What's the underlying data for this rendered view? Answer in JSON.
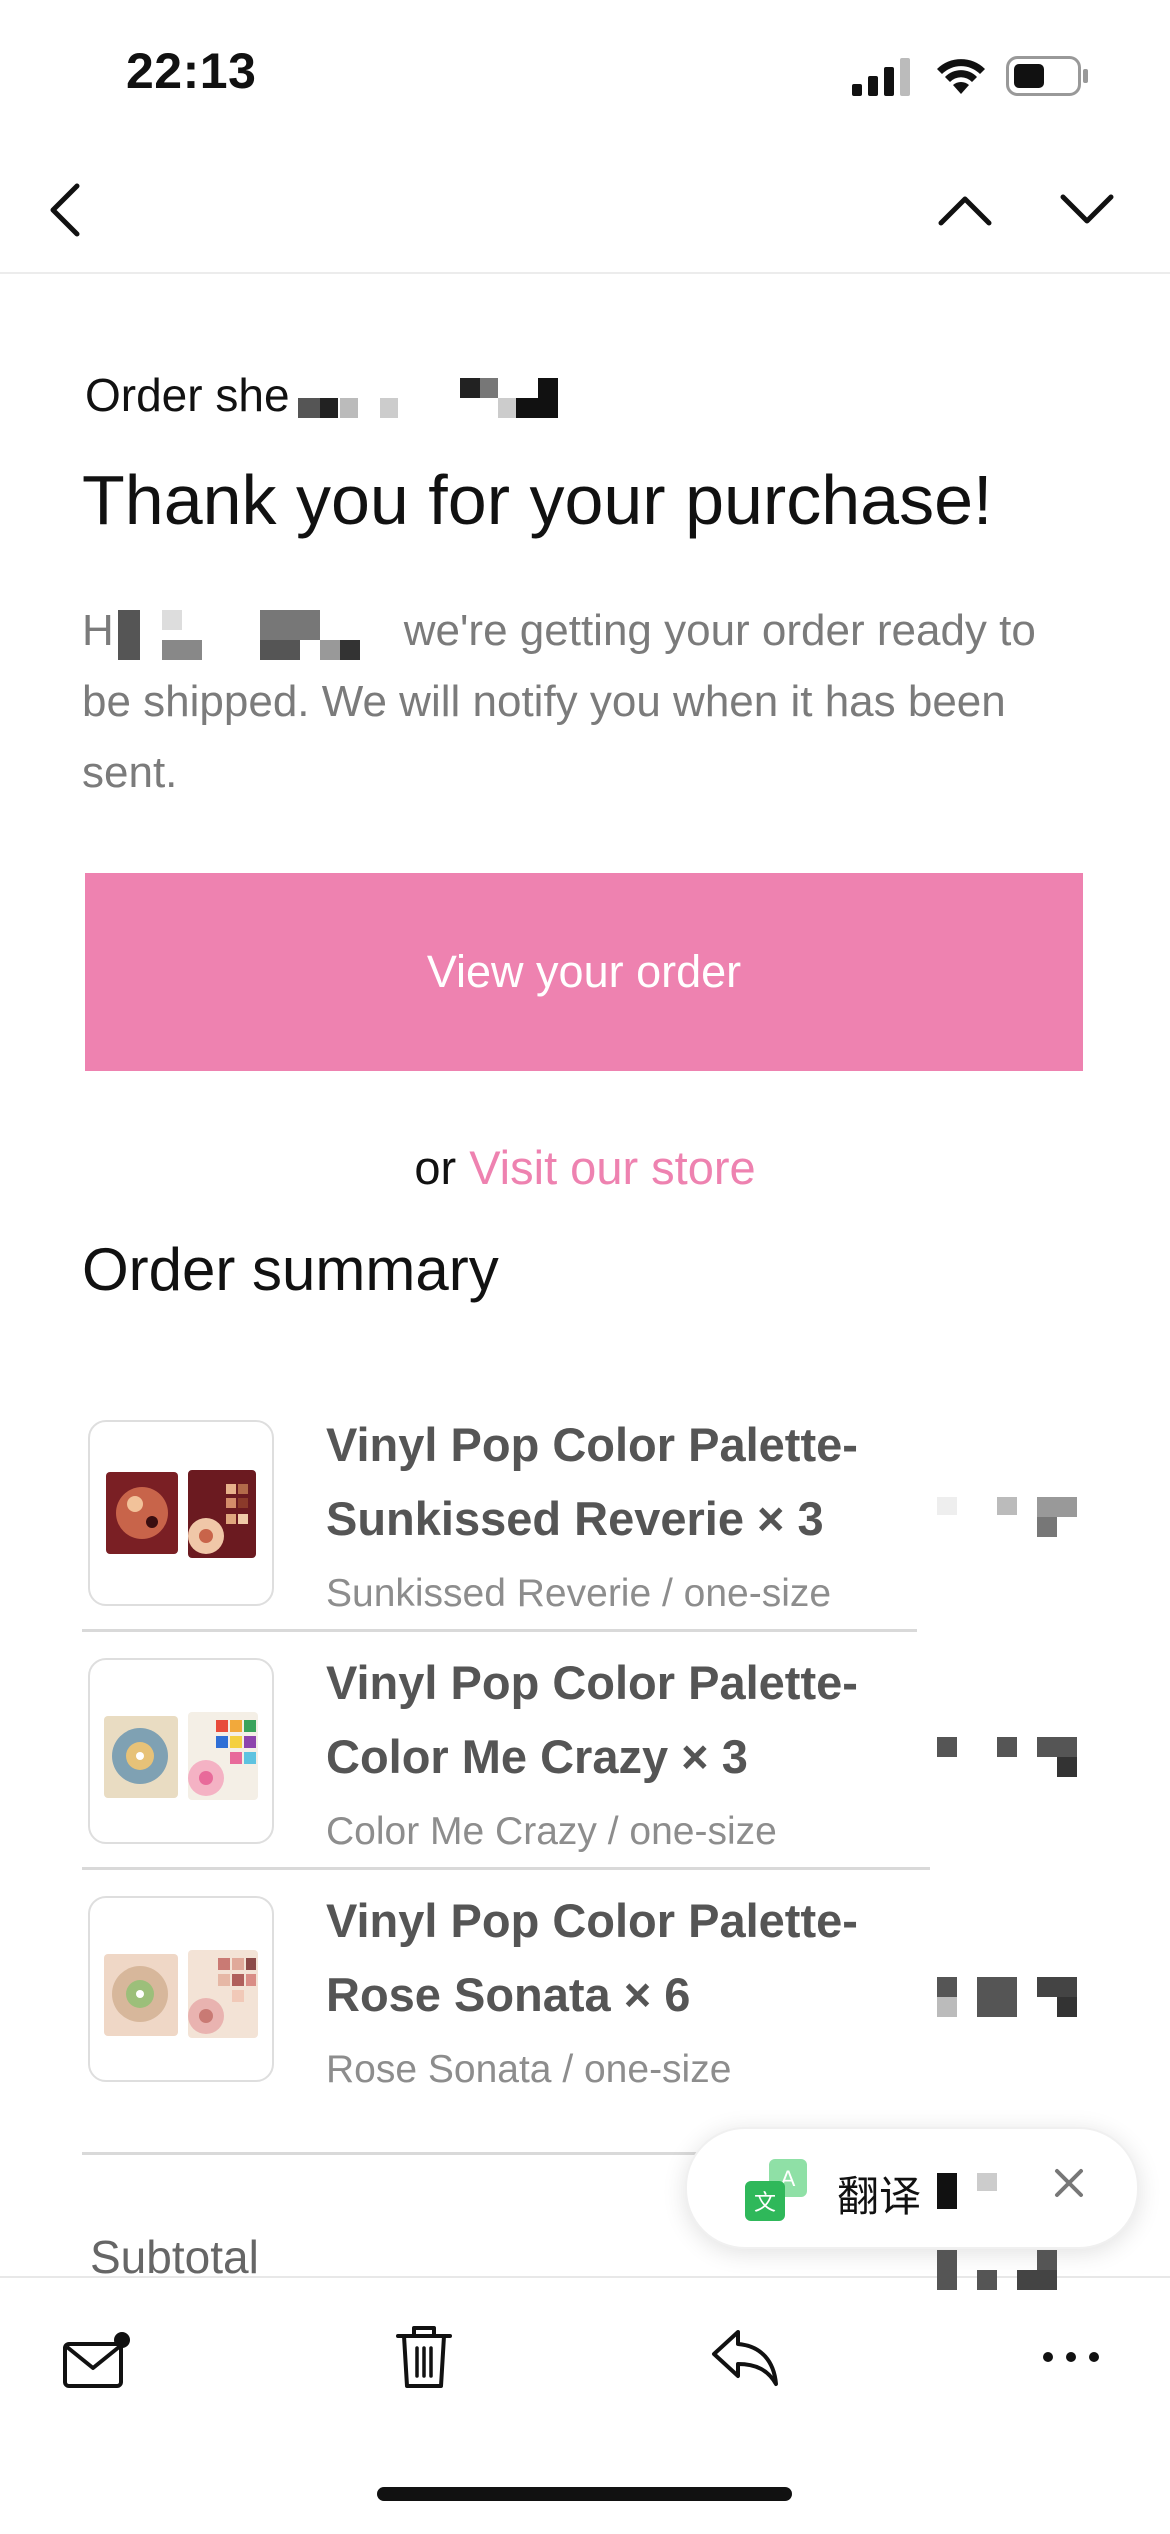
{
  "status_bar": {
    "time": "22:13",
    "icons": [
      "cellular-signal-icon",
      "wifi-icon",
      "battery-icon"
    ]
  },
  "nav": {
    "icons": [
      "back-chevron-icon",
      "previous-message-icon",
      "next-message-icon"
    ]
  },
  "email": {
    "preheader": "Order she",
    "headline": "Thank you for your purchase!",
    "intro_start": "H",
    "intro_rest": "we're getting your order ready to be shipped. We will notify you when it has been sent.",
    "cta_label": "View your order",
    "or_text": "or ",
    "store_link": "Visit our store",
    "summary_title": "Order summary",
    "items": [
      {
        "title_line1": "Vinyl Pop Color Palette-",
        "title_line2": "Sunkissed Reverie × 3",
        "variant": "Sunkissed Reverie / one-size"
      },
      {
        "title_line1": "Vinyl Pop Color Palette-",
        "title_line2": "Color Me Crazy × 3",
        "variant": "Color Me Crazy / one-size"
      },
      {
        "title_line1": "Vinyl Pop Color Palette-",
        "title_line2": "Rose Sonata × 6",
        "variant": "Rose Sonata / one-size"
      }
    ],
    "subtotal_label": "Subtotal"
  },
  "translate_popup": {
    "label": "翻译",
    "icons": [
      "translate-icon",
      "close-icon"
    ]
  },
  "toolbar": {
    "icons": [
      "mail-icon",
      "trash-icon",
      "reply-icon",
      "more-icon"
    ]
  },
  "colors": {
    "accent_pink": "#ee82b0",
    "text_gray": "#7b7b7b",
    "translate_green": "#3cc26a"
  }
}
